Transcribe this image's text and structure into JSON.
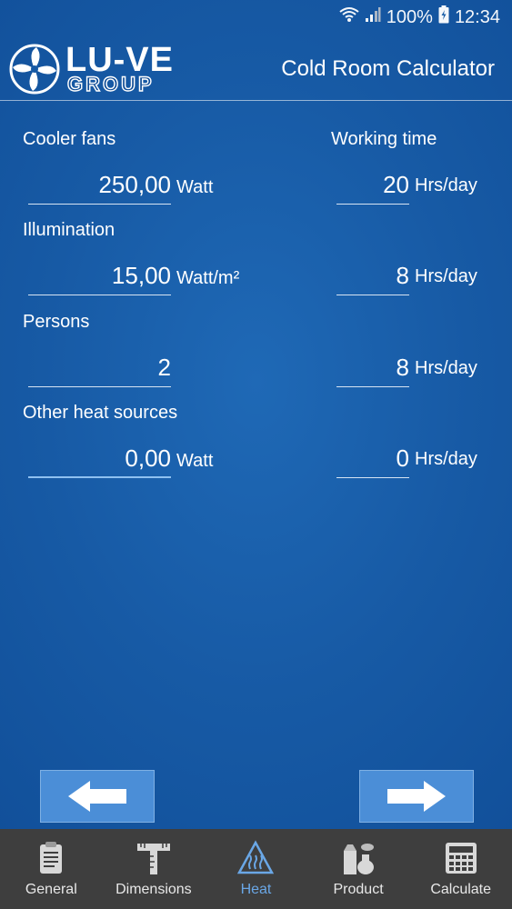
{
  "status_bar": {
    "battery": "100%",
    "time": "12:34"
  },
  "header": {
    "brand": "LU-VE",
    "group": "GROUP",
    "title": "Cold Room Calculator"
  },
  "columns": {
    "left": "Cooler fans",
    "right": "Working time"
  },
  "rows": [
    {
      "label": "",
      "value": "250,00",
      "unit": "Watt",
      "time_value": "20",
      "time_unit": "Hrs/day"
    },
    {
      "label": "Illumination",
      "value": "15,00",
      "unit": "Watt/m²",
      "time_value": "8",
      "time_unit": "Hrs/day"
    },
    {
      "label": "Persons",
      "value": "2",
      "unit": "",
      "time_value": "8",
      "time_unit": "Hrs/day"
    },
    {
      "label": "Other heat sources",
      "value": "0,00",
      "unit": "Watt",
      "time_value": "0",
      "time_unit": "Hrs/day"
    }
  ],
  "nav": {
    "back_icon": "arrow-left-icon",
    "next_icon": "arrow-right-icon"
  },
  "tabs": [
    {
      "label": "General",
      "icon": "clipboard-icon"
    },
    {
      "label": "Dimensions",
      "icon": "ruler-icon"
    },
    {
      "label": "Heat",
      "icon": "heat-icon",
      "selected": true
    },
    {
      "label": "Product",
      "icon": "product-icon"
    },
    {
      "label": "Calculate",
      "icon": "calculator-icon"
    }
  ],
  "colors": {
    "accent": "#6aa7e6",
    "background": "#175aa5",
    "tab_bar": "#3e3e3e",
    "button": "#4b8ed7"
  }
}
